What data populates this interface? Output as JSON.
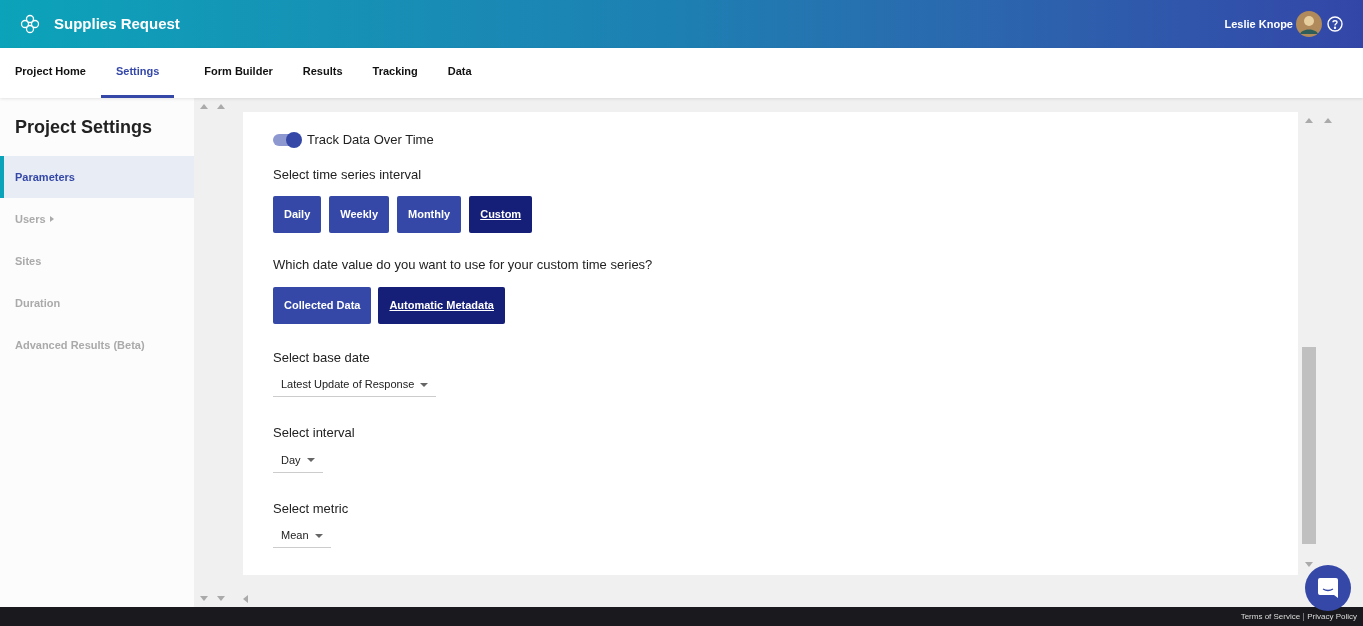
{
  "header": {
    "title": "Supplies Request",
    "user_name": "Leslie Knope"
  },
  "nav_tabs": [
    {
      "label": "Project Home",
      "selected": false
    },
    {
      "label": "Settings",
      "selected": true
    },
    {
      "label": "Form Builder",
      "selected": false
    },
    {
      "label": "Results",
      "selected": false
    },
    {
      "label": "Tracking",
      "selected": false
    },
    {
      "label": "Data",
      "selected": false
    }
  ],
  "sidebar": {
    "title": "Project Settings",
    "items": [
      {
        "label": "Parameters",
        "selected": true,
        "kind": "link"
      },
      {
        "label": "Users",
        "selected": false,
        "kind": "submenu"
      },
      {
        "label": "Sites",
        "selected": false,
        "kind": "link"
      },
      {
        "label": "Duration",
        "selected": false,
        "kind": "link"
      },
      {
        "label": "Advanced Results (Beta)",
        "selected": false,
        "kind": "link"
      }
    ]
  },
  "settings": {
    "toggle": {
      "label": "Track Data Over Time",
      "on": true
    },
    "interval": {
      "label": "Select time series interval",
      "options": [
        {
          "label": "Daily",
          "selected": false
        },
        {
          "label": "Weekly",
          "selected": false
        },
        {
          "label": "Monthly",
          "selected": false
        },
        {
          "label": "Custom",
          "selected": true
        }
      ]
    },
    "date_value": {
      "label": "Which date value do you want to use for your custom time series?",
      "options": [
        {
          "label": "Collected Data",
          "selected": false
        },
        {
          "label": "Automatic Metadata",
          "selected": true
        }
      ]
    },
    "dropdowns": [
      {
        "label": "Select base date",
        "value": "Latest Update of Response"
      },
      {
        "label": "Select interval",
        "value": "Day"
      },
      {
        "label": "Select metric",
        "value": "Mean"
      }
    ]
  },
  "footer": {
    "links": [
      "Terms of Service",
      "Privacy Policy"
    ]
  }
}
